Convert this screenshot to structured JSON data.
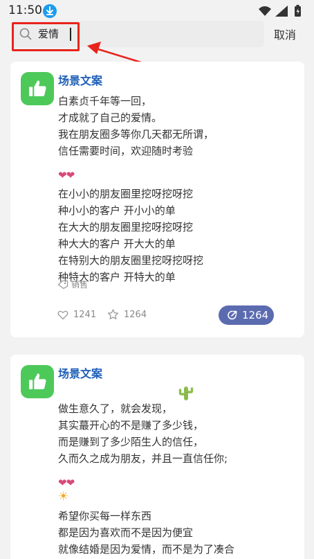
{
  "status_bar": {
    "time": "11:50"
  },
  "search": {
    "query": "爱情",
    "cancel_label": "取消"
  },
  "cards": [
    {
      "app_name": "场景文案",
      "lines_a": [
        "白素贞千年等一回，",
        "才成就了自己的爱情。",
        "我在朋友圈多等你几天都无所谓，",
        "信任需要时间，欢迎随时考验"
      ],
      "hearts": "❤❤",
      "lines_b": [
        "在小小的朋友圈里挖呀挖呀挖",
        "种小小的客户 开小小的单",
        "在大大的朋友圈里挖呀挖呀挖",
        "种大大的客户 开大大的单",
        "在特别大的朋友圈里挖呀挖呀挖",
        "种特大的客户 开特大的单"
      ],
      "tag": "销售",
      "likes": "1241",
      "favorites": "1264",
      "shares": "1264"
    },
    {
      "app_name": "场景文案",
      "lines_a": [
        "做生意久了，就会发现，",
        "其实蕞开心的不是赚了多少钱，",
        "而是赚到了多少陌生人的信任，",
        "久而久之成为朋友，并且一直信任你;"
      ],
      "hearts": "❤❤",
      "sun": "☀",
      "lines_b": [
        "希望你买每一样东西",
        "都是因为喜欢而不是因为便宜",
        "就像结婚是因为爱情，而不是为了凑合"
      ]
    }
  ],
  "colors": {
    "accent_blue": "#1f5fb8",
    "app_green": "#4dc95a",
    "highlight_red": "#e8231c",
    "share_button": "#5b6bb0"
  }
}
